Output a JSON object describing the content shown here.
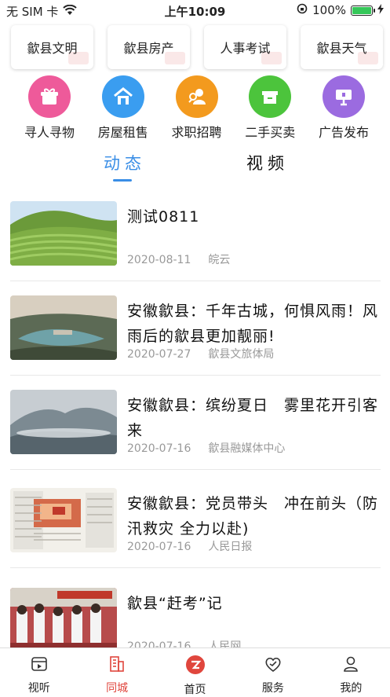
{
  "status_bar": {
    "carrier": "无 SIM 卡",
    "time": "上午10:09",
    "battery": "100%"
  },
  "quick_links": [
    {
      "label": "歙县文明"
    },
    {
      "label": "歙县房产"
    },
    {
      "label": "人事考试"
    },
    {
      "label": "歙县天气"
    }
  ],
  "services": [
    {
      "label": "寻人寻物",
      "icon": "gift-icon",
      "color": "#ee5a9a"
    },
    {
      "label": "房屋租售",
      "icon": "house-icon",
      "color": "#3a9df0"
    },
    {
      "label": "求职招聘",
      "icon": "job-icon",
      "color": "#f39a1e"
    },
    {
      "label": "二手买卖",
      "icon": "box-icon",
      "color": "#4cc43c"
    },
    {
      "label": "广告发布",
      "icon": "billboard-icon",
      "color": "#9b6be0"
    }
  ],
  "tabs": {
    "active": "动态",
    "inactive": "视频"
  },
  "news": [
    {
      "title": "测试0811",
      "date": "2020-08-11",
      "source": "皖云"
    },
    {
      "title": "安徽歙县：千年古城，何惧风雨！风雨后的歙县更加靓丽!",
      "date": "2020-07-27",
      "source": "歙县文旅体局"
    },
    {
      "title": "安徽歙县：缤纷夏日　雾里花开引客来",
      "date": "2020-07-16",
      "source": "歙县融媒体中心"
    },
    {
      "title": "安徽歙县：党员带头　冲在前头（防汛救灾 全力以赴)",
      "date": "2020-07-16",
      "source": "人民日报"
    },
    {
      "title": "歙县“赶考”记",
      "date": "2020-07-16",
      "source": "人民网"
    }
  ],
  "tabbar": [
    {
      "label": "视听",
      "icon": "video-icon"
    },
    {
      "label": "同城",
      "icon": "city-icon"
    },
    {
      "label": "首页",
      "icon": "home-icon"
    },
    {
      "label": "服务",
      "icon": "service-icon"
    },
    {
      "label": "我的",
      "icon": "profile-icon"
    }
  ]
}
